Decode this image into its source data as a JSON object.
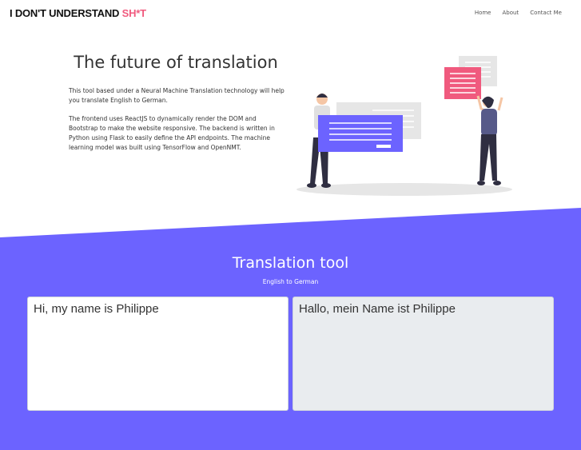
{
  "navbar": {
    "brand_main": "I DON'T UNDERSTAND ",
    "brand_accent": "SH*T",
    "links": [
      "Home",
      "About",
      "Contact Me"
    ]
  },
  "hero": {
    "title": "The future of translation",
    "paragraph1": "This tool based under a Neural Machine Translation technology will help you translate English to German.",
    "paragraph2": "The frontend uses ReactJS to dynamically render the DOM and Bootstrap to make the website responsive. The backend is written in Python using Flask to easily define the API endpoints. The machine learning model was built using TensorFlow and OpenNMT."
  },
  "translation": {
    "title": "Translation tool",
    "subtitle": "English to German",
    "source_text": "Hi, my name is Philippe",
    "translated_text": "Hallo, mein Name ist Philippe"
  },
  "colors": {
    "accent": "#f05a7e",
    "primary": "#6c63ff",
    "output_bg": "#e9ecef"
  }
}
